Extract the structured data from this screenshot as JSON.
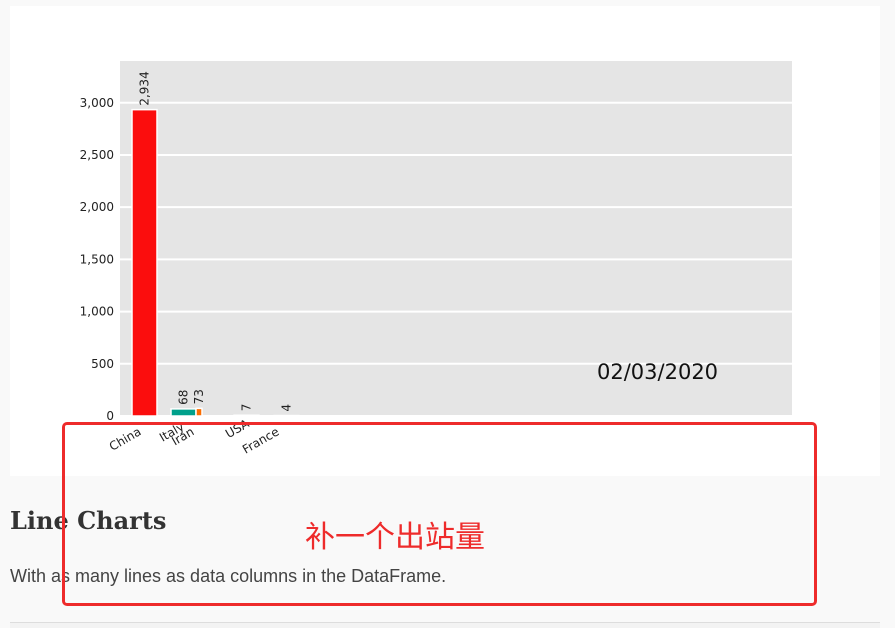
{
  "chart_data": {
    "type": "bar",
    "categories": [
      "China",
      "Italy",
      "Iran",
      "USA",
      "France"
    ],
    "values": [
      2934,
      68,
      73,
      7,
      4
    ],
    "value_labels": [
      "2,934",
      "68",
      "73",
      "7",
      "4"
    ],
    "colors": [
      "#fb0d0d",
      "#00a08b",
      "#fb6d00",
      "#d7e6ff",
      "#fef0d9"
    ],
    "title": "",
    "xlabel": "",
    "ylabel": "",
    "ylim": [
      0,
      3400
    ],
    "yticks": [
      0,
      500,
      1000,
      1500,
      2000,
      2500,
      3000
    ],
    "ytick_labels": [
      "0",
      "500",
      "1,000",
      "1,500",
      "2,000",
      "2,500",
      "3,000"
    ],
    "grid": true,
    "plot_bg": "#e5e5e5"
  },
  "overlay": {
    "date": "02/03/2020",
    "note": "补一个出站量",
    "note_color": "#ee2b2b"
  },
  "section": {
    "title": "Line Charts",
    "text": "With as many lines as data columns in the DataFrame."
  }
}
